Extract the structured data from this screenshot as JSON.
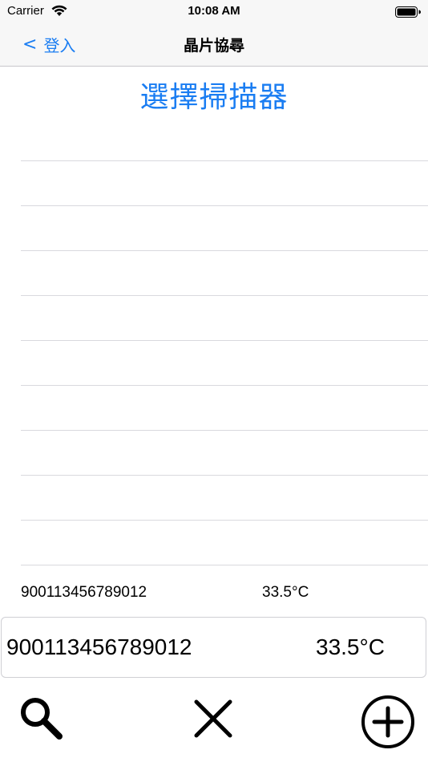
{
  "status_bar": {
    "carrier": "Carrier",
    "time": "10:08 AM"
  },
  "nav": {
    "back_label": "登入",
    "title": "晶片協尋"
  },
  "scanner": {
    "select_label": "選擇掃描器",
    "rows": [
      "",
      "",
      "",
      "",
      "",
      "",
      "",
      "",
      "",
      ""
    ]
  },
  "list_summary": {
    "chip_id": "900113456789012",
    "temperature": "33.5°C"
  },
  "reading": {
    "chip_id": "900113456789012",
    "temperature": "33.5°C"
  },
  "toolbar": {
    "search_icon": "search-icon",
    "clear_icon": "close-icon",
    "add_icon": "add-circle-icon"
  },
  "colors": {
    "accent": "#1a7df2",
    "bar_background": "#f7f7f7",
    "separator": "#d9d9de"
  }
}
